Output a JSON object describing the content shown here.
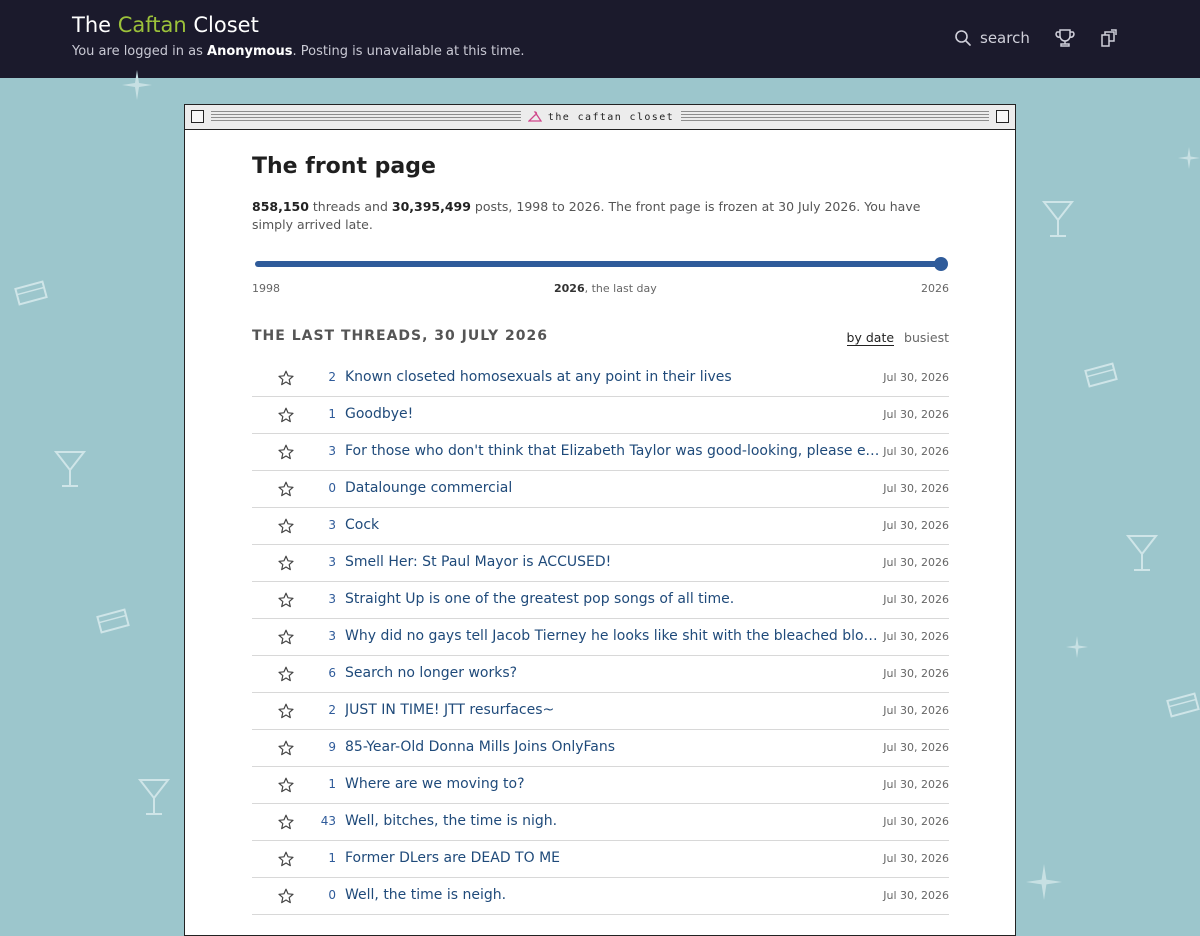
{
  "header": {
    "title_pre": "The ",
    "title_accent": "Caftan",
    "title_post": " Closet",
    "login_pre": "You are logged in as ",
    "login_user": "Anonymous",
    "login_post": ". Posting is unavailable at this time.",
    "search_label": "search",
    "search_icon": "search-icon",
    "trophy_icon": "trophy-icon",
    "exit_icon": "door-exit-icon"
  },
  "window": {
    "title": "the caftan closet",
    "hanger_icon": "hanger-icon"
  },
  "page": {
    "heading": "The front page",
    "threads_count": "858,150",
    "threads_word": " threads and ",
    "posts_count": "30,395,499",
    "posts_rest": " posts, 1998 to 2026. The front page is frozen at 30 July 2026. You have simply arrived late."
  },
  "timeline": {
    "start": "1998",
    "current_year": "2026",
    "current_note": ", the last day",
    "end": "2026",
    "position": 1.0
  },
  "list": {
    "heading": "THE LAST THREADS, 30 JULY 2026",
    "sort_active": "by date",
    "sort_other": "busiest",
    "threads": [
      {
        "count": "2",
        "title": "Known closeted homosexuals at any point in their lives",
        "date": "Jul 30, 2026"
      },
      {
        "count": "1",
        "title": "Goodbye!",
        "date": "Jul 30, 2026"
      },
      {
        "count": "3",
        "title": "For those who don't think that Elizabeth Taylor was good-looking, please explain",
        "date": "Jul 30, 2026"
      },
      {
        "count": "0",
        "title": "Datalounge commercial",
        "date": "Jul 30, 2026"
      },
      {
        "count": "3",
        "title": "Cock",
        "date": "Jul 30, 2026"
      },
      {
        "count": "3",
        "title": "Smell Her: St Paul Mayor is ACCUSED!",
        "date": "Jul 30, 2026"
      },
      {
        "count": "3",
        "title": "Straight Up is one of the greatest pop songs of all time.",
        "date": "Jul 30, 2026"
      },
      {
        "count": "3",
        "title": "Why did no gays tell Jacob Tierney he looks like shit with the bleached blond look?",
        "date": "Jul 30, 2026"
      },
      {
        "count": "6",
        "title": "Search no longer works?",
        "date": "Jul 30, 2026"
      },
      {
        "count": "2",
        "title": "JUST IN TIME! JTT resurfaces~",
        "date": "Jul 30, 2026"
      },
      {
        "count": "9",
        "title": "85-Year-Old Donna Mills Joins OnlyFans",
        "date": "Jul 30, 2026"
      },
      {
        "count": "1",
        "title": "Where are we moving to?",
        "date": "Jul 30, 2026"
      },
      {
        "count": "43",
        "title": "Well, bitches, the time is nigh.",
        "date": "Jul 30, 2026"
      },
      {
        "count": "1",
        "title": "Former DLers are DEAD TO ME",
        "date": "Jul 30, 2026"
      },
      {
        "count": "0",
        "title": "Well, the time is neigh.",
        "date": "Jul 30, 2026"
      }
    ]
  },
  "colors": {
    "background": "#9cc6cc",
    "header_bg": "#1b1a2c",
    "accent": "#9cc23a",
    "link": "#1f4a7a",
    "slider": "#2f5b9a"
  }
}
